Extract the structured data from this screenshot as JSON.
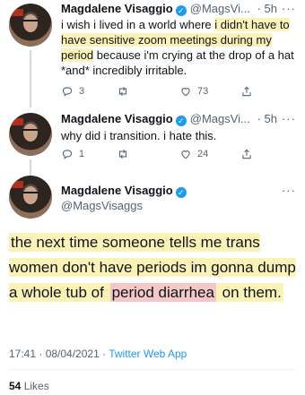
{
  "tweet1": {
    "name": "Magdalene Visaggio",
    "handle": "@MagsVi...",
    "time": "· 5h",
    "text_pre": "i wish i lived in a world where ",
    "text_hl": "i didn't have to have sensitive zoom meetings during my period",
    "text_post": " because i'm crying at the drop of a hat *and* incredibly irritable.",
    "replies": "3",
    "likes": "73"
  },
  "tweet2": {
    "name": "Magdalene Visaggio",
    "handle": "@MagsVi...",
    "time": "· 5h",
    "text": "why did i transition. i hate this.",
    "replies": "1",
    "likes": "24"
  },
  "main": {
    "name": "Magdalene Visaggio",
    "handle": "@MagsVisaggs",
    "text_pre": "the next time someone tells me trans women don't have periods im gonna dump a whole tub of ",
    "text_red": "period diarrhea",
    "text_post": " on them.",
    "timestamp": "17:41 · 08/04/2021 · ",
    "app": "Twitter Web App",
    "likes_count": "54",
    "likes_label": " Likes"
  },
  "ui": {
    "more": "···",
    "verified": "✓"
  }
}
